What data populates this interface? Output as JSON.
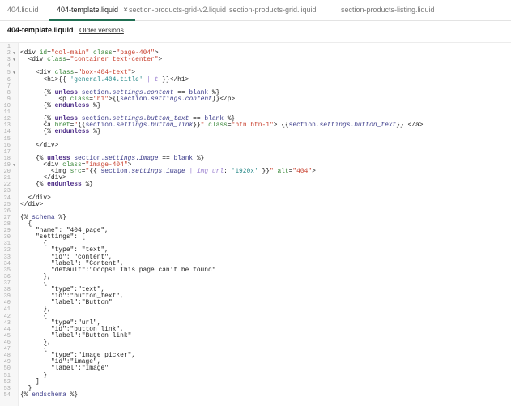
{
  "tabs": [
    {
      "label": "404.liquid",
      "active": false
    },
    {
      "label": "404-template.liquid",
      "active": true,
      "close": "×"
    },
    {
      "label": "section-products-grid-v2.liquid",
      "active": false
    },
    {
      "label": "section-products-grid.liquid",
      "active": false
    },
    {
      "label": "section-products-listing.liquid",
      "active": false
    }
  ],
  "file": {
    "name": "404-template.liquid",
    "older_versions": "Older versions"
  },
  "folds": [
    2,
    3,
    5,
    19
  ],
  "lines": [
    [],
    [
      [
        "p",
        "<div "
      ],
      [
        "a",
        "id"
      ],
      [
        "p",
        "="
      ],
      [
        "s",
        "\"col-main\""
      ],
      [
        "p",
        " "
      ],
      [
        "a",
        "class"
      ],
      [
        "p",
        "="
      ],
      [
        "s",
        "\"page-404\""
      ],
      [
        "p",
        ">"
      ]
    ],
    [
      [
        "p",
        "  <div "
      ],
      [
        "a",
        "class"
      ],
      [
        "p",
        "="
      ],
      [
        "s",
        "\"container text-center\""
      ],
      [
        "p",
        ">"
      ]
    ],
    [],
    [
      [
        "p",
        "    <div "
      ],
      [
        "a",
        "class"
      ],
      [
        "p",
        "="
      ],
      [
        "s",
        "\"box-404-text\""
      ],
      [
        "p",
        ">"
      ]
    ],
    [
      [
        "p",
        "      <h1>{{ "
      ],
      [
        "q",
        "'general.404.title'"
      ],
      [
        "p",
        " "
      ],
      [
        "f",
        "| t"
      ],
      [
        "p",
        " }}</h1>"
      ]
    ],
    [],
    [
      [
        "p",
        "      {% "
      ],
      [
        "k",
        "unless"
      ],
      [
        "v",
        " section."
      ],
      [
        "i",
        "settings"
      ],
      [
        "v",
        "."
      ],
      [
        "i",
        "content"
      ],
      [
        "p",
        " == "
      ],
      [
        "v",
        "blank"
      ],
      [
        "p",
        " %}"
      ]
    ],
    [
      [
        "p",
        "          <p "
      ],
      [
        "a",
        "class"
      ],
      [
        "p",
        "="
      ],
      [
        "s",
        "\"h1\""
      ],
      [
        "p",
        ">{{"
      ],
      [
        "v",
        "section."
      ],
      [
        "i",
        "settings"
      ],
      [
        "v",
        "."
      ],
      [
        "i",
        "content"
      ],
      [
        "p",
        "}}</p>"
      ]
    ],
    [
      [
        "p",
        "      {% "
      ],
      [
        "k",
        "endunless"
      ],
      [
        "p",
        " %}"
      ]
    ],
    [],
    [
      [
        "p",
        "      {% "
      ],
      [
        "k",
        "unless"
      ],
      [
        "v",
        " section."
      ],
      [
        "i",
        "settings"
      ],
      [
        "v",
        "."
      ],
      [
        "i",
        "button_text"
      ],
      [
        "p",
        " == "
      ],
      [
        "v",
        "blank"
      ],
      [
        "p",
        " %}"
      ]
    ],
    [
      [
        "p",
        "      <a "
      ],
      [
        "a",
        "href"
      ],
      [
        "p",
        "="
      ],
      [
        "s",
        "\""
      ],
      [
        "p",
        "{{"
      ],
      [
        "v",
        "section."
      ],
      [
        "i",
        "settings"
      ],
      [
        "v",
        "."
      ],
      [
        "i",
        "button_link"
      ],
      [
        "p",
        "}}"
      ],
      [
        "s",
        "\""
      ],
      [
        "p",
        " "
      ],
      [
        "a",
        "class"
      ],
      [
        "p",
        "="
      ],
      [
        "s",
        "\"btn btn-1\""
      ],
      [
        "p",
        "> {{"
      ],
      [
        "v",
        "section."
      ],
      [
        "i",
        "settings"
      ],
      [
        "v",
        "."
      ],
      [
        "i",
        "button_text"
      ],
      [
        "p",
        "}} </a>"
      ]
    ],
    [
      [
        "p",
        "      {% "
      ],
      [
        "k",
        "endunless"
      ],
      [
        "p",
        " %}"
      ]
    ],
    [],
    [
      [
        "p",
        "    </div>"
      ]
    ],
    [],
    [
      [
        "p",
        "    {% "
      ],
      [
        "k",
        "unless"
      ],
      [
        "v",
        " section."
      ],
      [
        "i",
        "settings"
      ],
      [
        "v",
        "."
      ],
      [
        "i",
        "image"
      ],
      [
        "p",
        " == "
      ],
      [
        "v",
        "blank"
      ],
      [
        "p",
        " %}"
      ]
    ],
    [
      [
        "p",
        "      <div "
      ],
      [
        "a",
        "class"
      ],
      [
        "p",
        "="
      ],
      [
        "s",
        "\"image-404\""
      ],
      [
        "p",
        ">"
      ]
    ],
    [
      [
        "p",
        "        <img "
      ],
      [
        "a",
        "src"
      ],
      [
        "p",
        "="
      ],
      [
        "s",
        "\""
      ],
      [
        "p",
        "{{ "
      ],
      [
        "v",
        "section."
      ],
      [
        "i",
        "settings"
      ],
      [
        "v",
        "."
      ],
      [
        "i",
        "image"
      ],
      [
        "p",
        " "
      ],
      [
        "f",
        "| img_url"
      ],
      [
        "p",
        ": "
      ],
      [
        "q",
        "'1920x'"
      ],
      [
        "p",
        " }}"
      ],
      [
        "s",
        "\""
      ],
      [
        "p",
        " "
      ],
      [
        "a",
        "alt"
      ],
      [
        "p",
        "="
      ],
      [
        "s",
        "\"404\""
      ],
      [
        "p",
        ">"
      ]
    ],
    [
      [
        "p",
        "      </div>"
      ]
    ],
    [
      [
        "p",
        "    {% "
      ],
      [
        "k",
        "endunless"
      ],
      [
        "p",
        " %}"
      ]
    ],
    [],
    [
      [
        "p",
        "  </div>"
      ]
    ],
    [
      [
        "p",
        "</div>"
      ]
    ],
    [],
    [
      [
        "p",
        "{% "
      ],
      [
        "v",
        "schema"
      ],
      [
        "p",
        " %}"
      ]
    ],
    [
      [
        "p",
        "  {"
      ]
    ],
    [
      [
        "p",
        "    \"name\": \"404 page\","
      ]
    ],
    [
      [
        "p",
        "    \"settings\": ["
      ]
    ],
    [
      [
        "p",
        "      {"
      ]
    ],
    [
      [
        "p",
        "        \"type\": \"text\","
      ]
    ],
    [
      [
        "p",
        "        \"id\": \"content\","
      ]
    ],
    [
      [
        "p",
        "        \"label\": \"Content\","
      ]
    ],
    [
      [
        "p",
        "        \"default\":\"Ooops! This page can't be found\""
      ]
    ],
    [
      [
        "p",
        "      },"
      ]
    ],
    [
      [
        "p",
        "      {"
      ]
    ],
    [
      [
        "p",
        "        \"type\":\"text\","
      ]
    ],
    [
      [
        "p",
        "        \"id\":\"button_text\","
      ]
    ],
    [
      [
        "p",
        "        \"label\":\"Button\""
      ]
    ],
    [
      [
        "p",
        "      },"
      ]
    ],
    [
      [
        "p",
        "      {"
      ]
    ],
    [
      [
        "p",
        "        \"type\":\"url\","
      ]
    ],
    [
      [
        "p",
        "        \"id\":\"button_link\","
      ]
    ],
    [
      [
        "p",
        "        \"label\":\"Button link\""
      ]
    ],
    [
      [
        "p",
        "      },"
      ]
    ],
    [
      [
        "p",
        "      {"
      ]
    ],
    [
      [
        "p",
        "        \"type\":\"image_picker\","
      ]
    ],
    [
      [
        "p",
        "        \"id\":\"image\","
      ]
    ],
    [
      [
        "p",
        "        \"label\":\"Image\""
      ]
    ],
    [
      [
        "p",
        "      }"
      ]
    ],
    [
      [
        "p",
        "    ]"
      ]
    ],
    [
      [
        "p",
        "  }"
      ]
    ],
    [
      [
        "p",
        "{% "
      ],
      [
        "v",
        "endschema"
      ],
      [
        "p",
        " %}"
      ]
    ]
  ]
}
